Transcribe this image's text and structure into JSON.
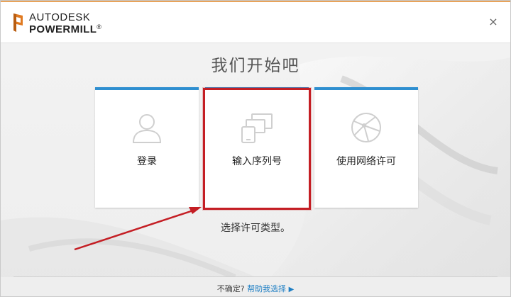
{
  "brand": {
    "line1": "AUTODESK",
    "line2": "POWERMILL",
    "registered": "®"
  },
  "window": {
    "close_glyph": "×"
  },
  "title": "我们开始吧",
  "cards": [
    {
      "label": "登录",
      "icon": "user-icon"
    },
    {
      "label": "输入序列号",
      "icon": "devices-icon"
    },
    {
      "label": "使用网络许可",
      "icon": "network-globe-icon"
    }
  ],
  "subtitle": "选择许可类型。",
  "footer": {
    "question": "不确定?",
    "help_link": "帮助我选择",
    "arrow": "▶"
  },
  "colors": {
    "accent_top": "#e8a35a",
    "card_top": "#2f8fd0",
    "highlight": "#c41e24",
    "link": "#1f7fc4"
  }
}
